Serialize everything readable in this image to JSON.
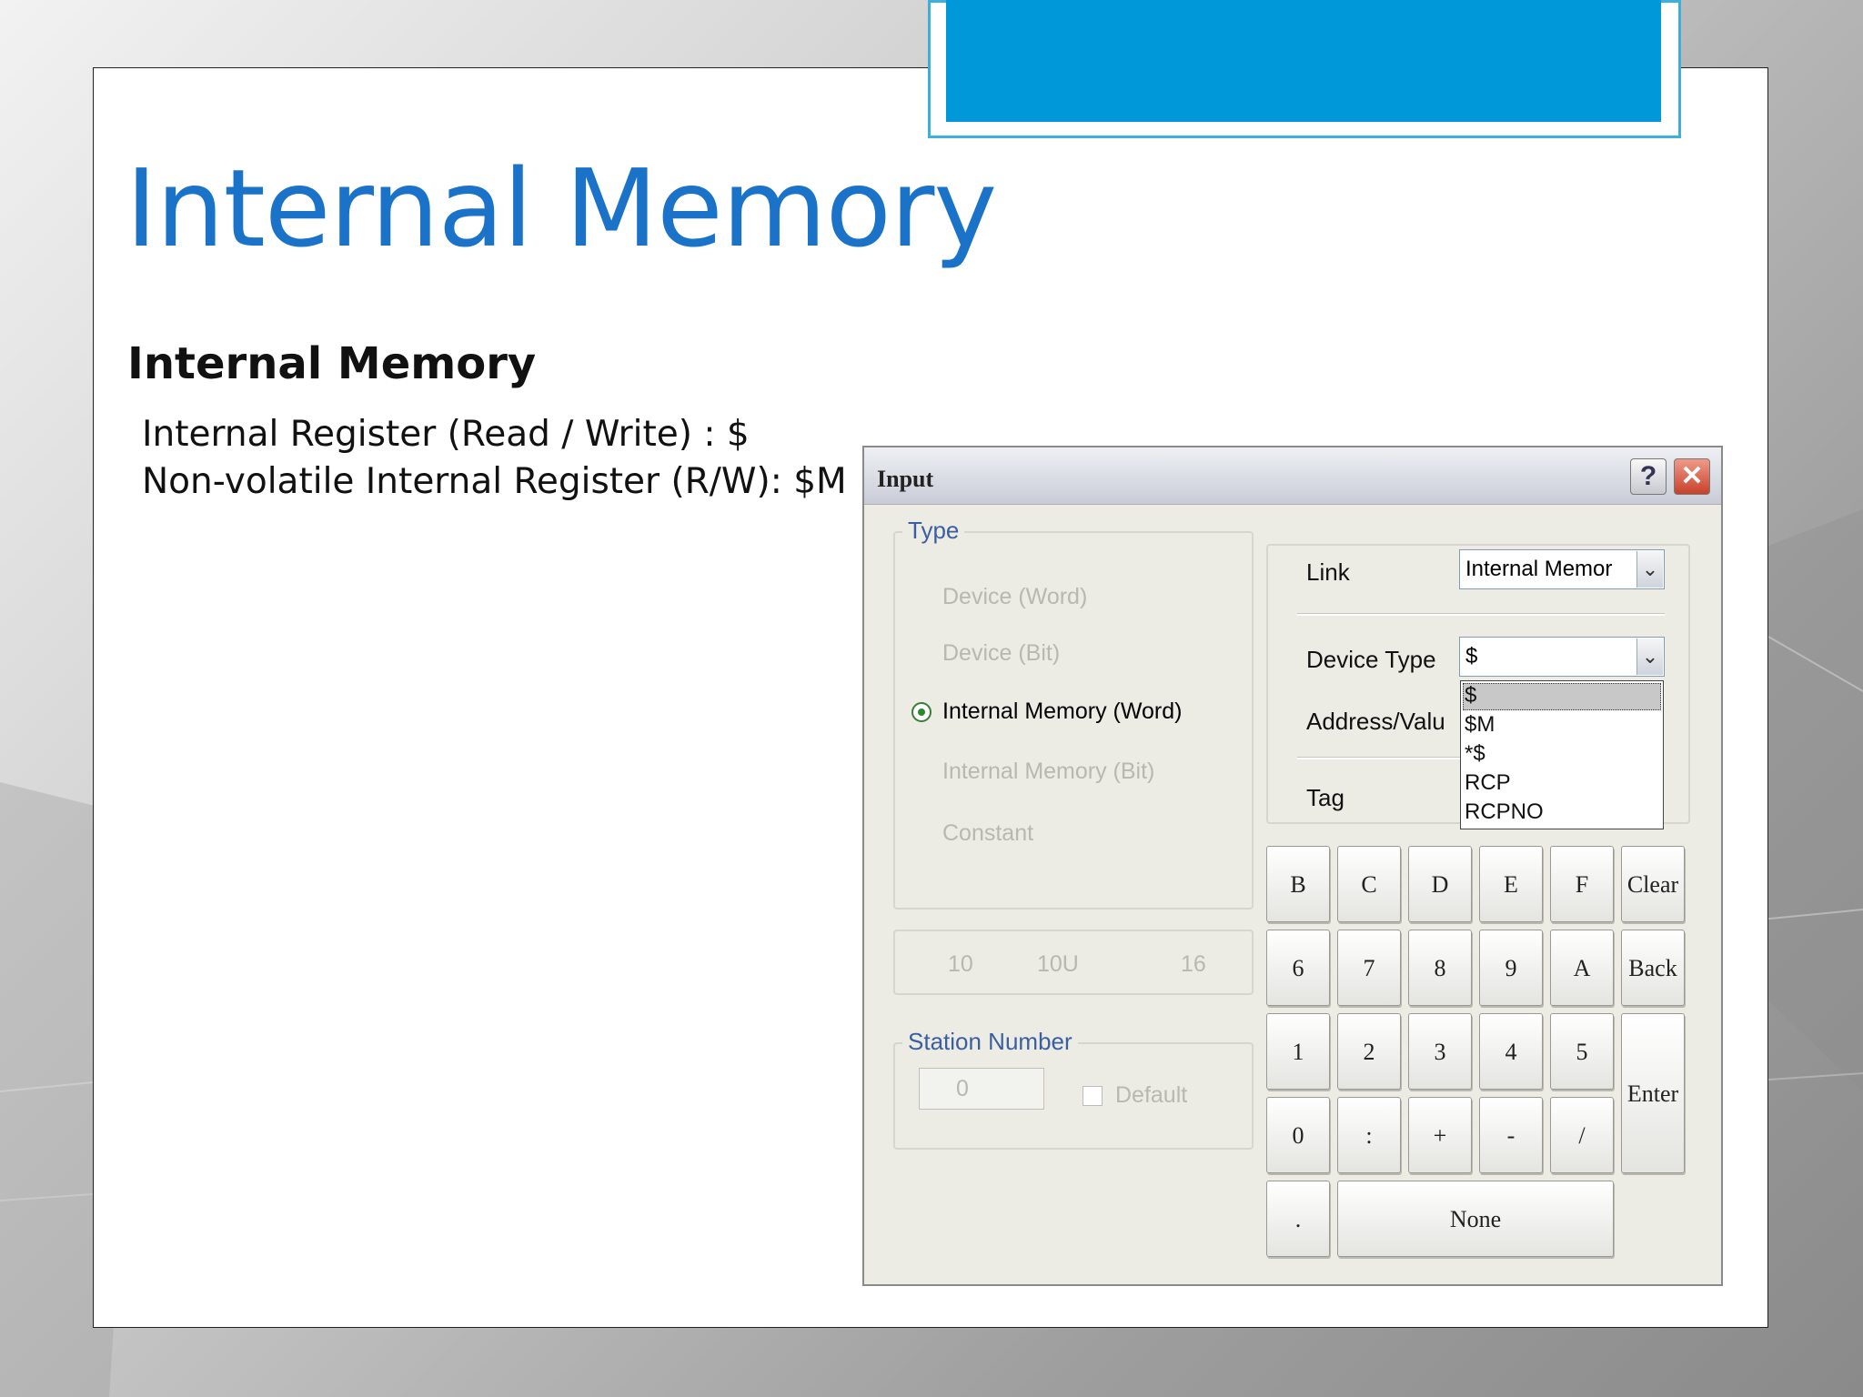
{
  "slide": {
    "title": "Internal Memory",
    "subtitle": "Internal Memory",
    "bullets": [
      "Internal Register (Read / Write) : $",
      "Non-volatile Internal Register (R/W): $M"
    ]
  },
  "dialog": {
    "title": "Input",
    "help_label": "?",
    "close_label": "✕",
    "type_group": {
      "legend": "Type",
      "options": [
        "Device (Word)",
        "Device (Bit)",
        "Internal Memory (Word)",
        "Internal Memory (Bit)",
        "Constant"
      ],
      "selected": "Internal Memory (Word)"
    },
    "radix": [
      "10",
      "10U",
      "16"
    ],
    "station": {
      "legend": "Station Number",
      "value": "0",
      "default_label": "Default"
    },
    "link": {
      "label": "Link",
      "value": "Internal Memor"
    },
    "device_type": {
      "label": "Device Type",
      "value": "$",
      "options": [
        "$",
        "$M",
        "*$",
        "RCP",
        "RCPNO"
      ]
    },
    "address_label": "Address/Valu",
    "tag_label": "Tag",
    "keypad": {
      "row1": [
        "B",
        "C",
        "D",
        "E",
        "F",
        "Clear"
      ],
      "row2": [
        "6",
        "7",
        "8",
        "9",
        "A",
        "Back"
      ],
      "row3": [
        "1",
        "2",
        "3",
        "4",
        "5"
      ],
      "row4": [
        "0",
        ":",
        "+",
        "-",
        "/"
      ],
      "enter": "Enter",
      "dot": ".",
      "none": "None"
    }
  },
  "colors": {
    "title": "#1a73c9",
    "accent": "#0098d9",
    "accent_border": "#3cb0da"
  }
}
